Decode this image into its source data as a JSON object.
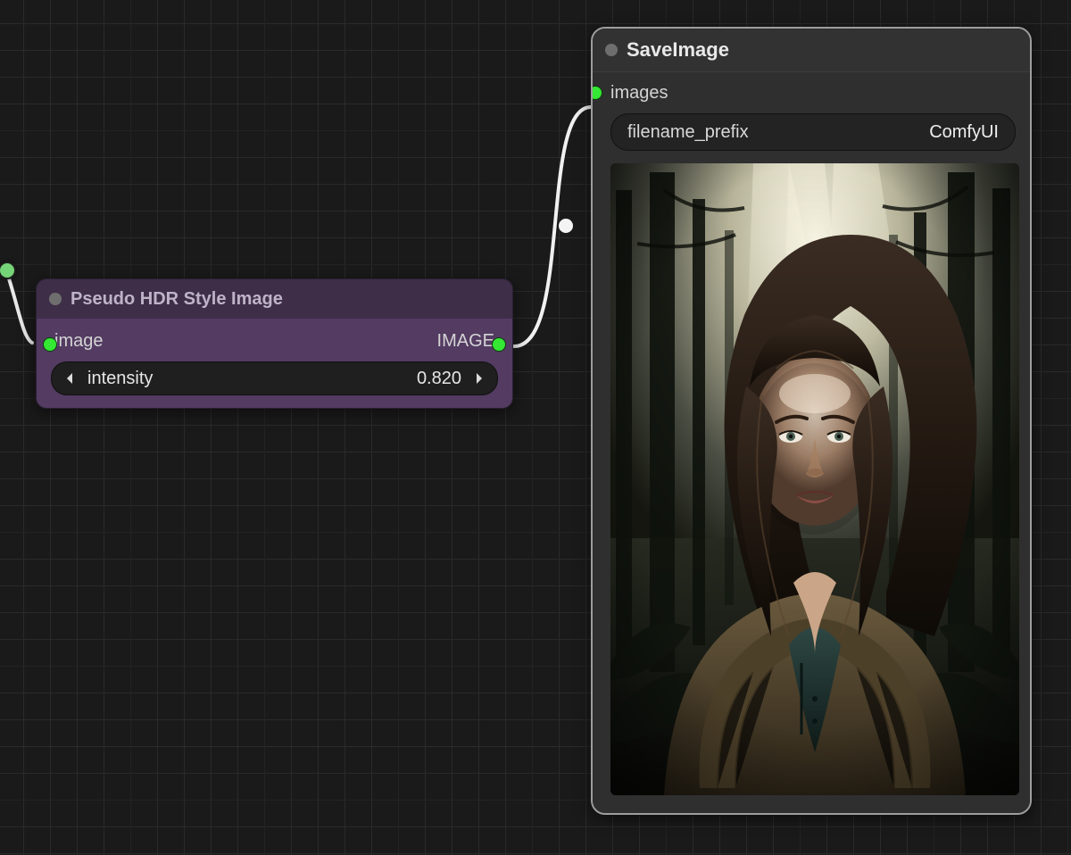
{
  "nodes": {
    "hdr": {
      "title": "Pseudo HDR Style Image",
      "input_label": "image",
      "output_label": "IMAGE",
      "widget_label": "intensity",
      "widget_value": "0.820"
    },
    "save": {
      "title": "SaveImage",
      "input_label": "images",
      "widget_label": "filename_prefix",
      "widget_value": "ComfyUI",
      "preview_alt": "Rendered portrait of a woman with long dark wavy hair wearing a heavy wool-collared coat, standing in a misty dark forest with light rays through trees"
    }
  },
  "colors": {
    "port_green": "#34e834"
  }
}
